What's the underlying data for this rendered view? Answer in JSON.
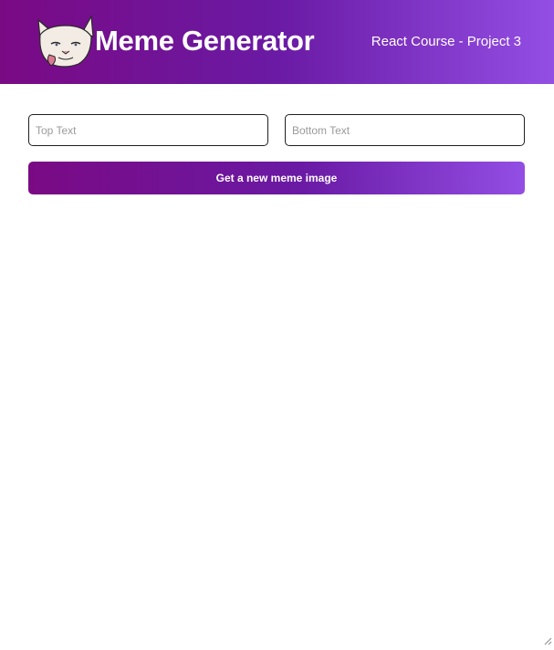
{
  "header": {
    "logo_icon": "troll-face-cat-icon",
    "title": "Meme Generator",
    "subtitle": "React Course - Project 3",
    "gradient_start": "#7a0a84",
    "gradient_end": "#934ee4"
  },
  "form": {
    "top_text": {
      "value": "",
      "placeholder": "Top Text"
    },
    "bottom_text": {
      "value": "",
      "placeholder": "Bottom Text"
    },
    "button_label": "Get a new meme image"
  }
}
